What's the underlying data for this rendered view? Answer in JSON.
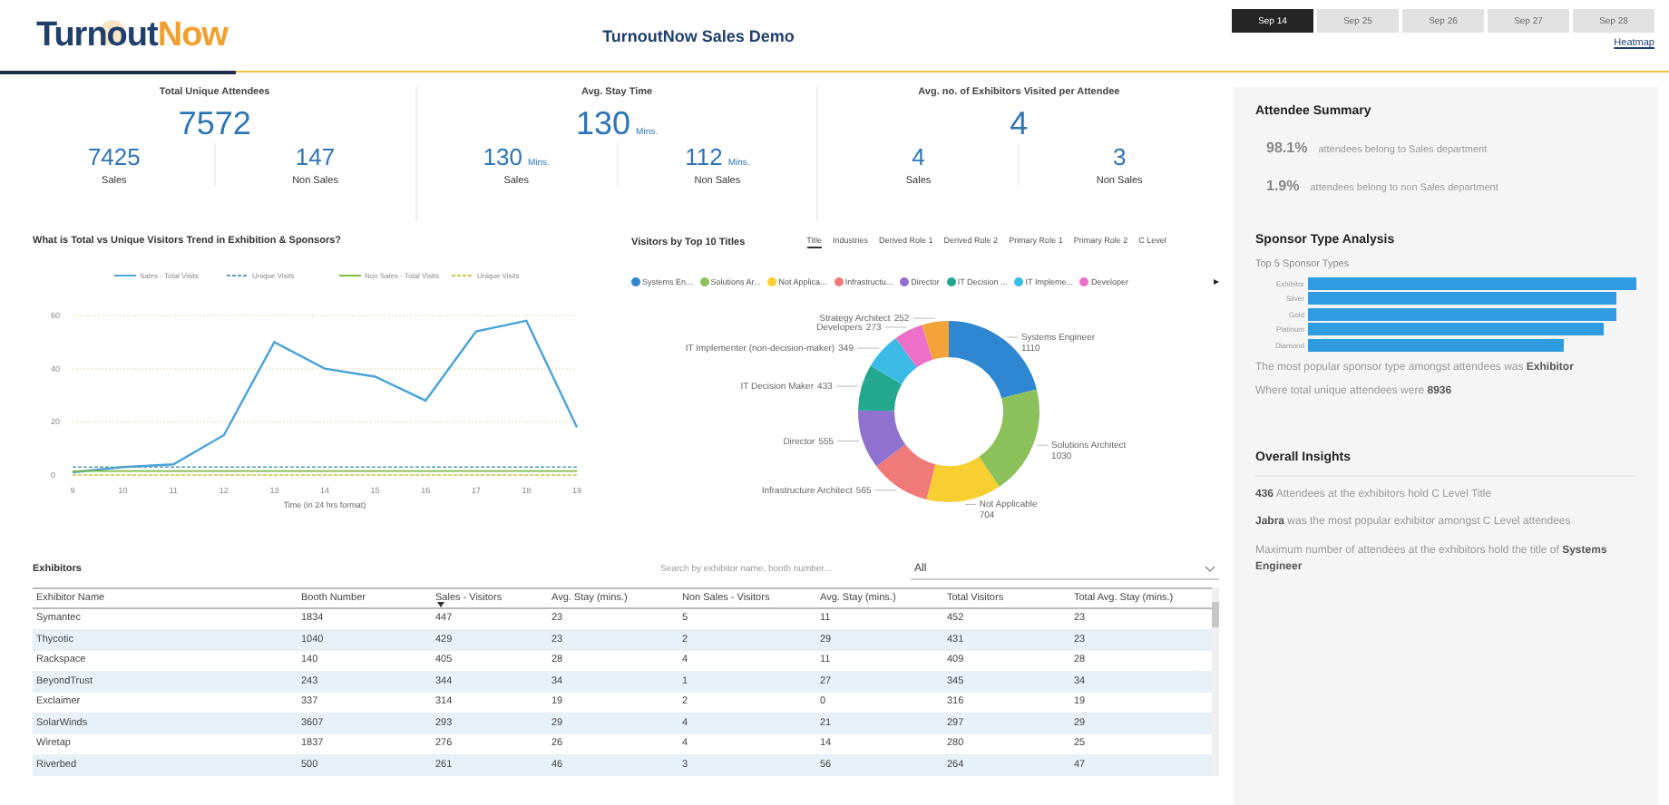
{
  "logo": {
    "text": "Turnout",
    "accent": "Now"
  },
  "title": "TurnoutNow Sales Demo",
  "date_tabs": [
    {
      "label": "Sep 14",
      "selected": true
    },
    {
      "label": "Sep 25",
      "selected": false
    },
    {
      "label": "Sep 26",
      "selected": false
    },
    {
      "label": "Sep 27",
      "selected": false
    },
    {
      "label": "Sep 28",
      "selected": false
    }
  ],
  "heatmap_link": "Heatmap",
  "kpis": [
    {
      "title": "Total Unique Attendees",
      "value": "7572",
      "split": [
        {
          "value": "7425",
          "label": "Sales"
        },
        {
          "value": "147",
          "label": "Non Sales"
        }
      ]
    },
    {
      "title": "Avg. Stay Time",
      "value": "130",
      "unit": "Mins.",
      "split": [
        {
          "value": "130",
          "unit": "Mins.",
          "label": "Sales"
        },
        {
          "value": "112",
          "unit": "Mins.",
          "label": "Non Sales"
        }
      ]
    },
    {
      "title": "Avg. no. of Exhibitors Visited per Attendee",
      "value": "4",
      "split": [
        {
          "value": "4",
          "label": "Sales"
        },
        {
          "value": "3",
          "label": "Non Sales"
        }
      ]
    }
  ],
  "trend": {
    "title": "What is Total vs Unique Visitors Trend in Exhibition & Sponsors?",
    "chart_data": {
      "type": "line",
      "legend": "top",
      "xlabel": "Time (in 24 hrs format)",
      "x": [
        "9",
        "10",
        "11",
        "12",
        "13",
        "14",
        "15",
        "16",
        "17",
        "18",
        "19"
      ],
      "ylim": [
        0,
        60
      ],
      "yticks": [
        0,
        20,
        40,
        60
      ],
      "series": [
        {
          "name": "Sales - Total Visits",
          "color": "#4aa3d9",
          "line_style": "solid",
          "values": [
            1,
            3,
            4,
            15,
            50,
            40,
            37,
            28,
            54,
            58,
            18
          ]
        },
        {
          "name": "Unique Visits",
          "color": "#5a9fb0",
          "line_style": "dashed",
          "values": [
            3,
            3,
            3,
            3,
            3,
            3,
            3,
            3,
            3,
            3,
            3
          ]
        },
        {
          "name": "Non Sales - Total Visits",
          "color": "#7cbd3e",
          "line_style": "solid",
          "values": [
            1.5,
            1.5,
            1.5,
            1.5,
            1.5,
            1.5,
            1.5,
            1.5,
            1.5,
            1.5,
            1.5
          ]
        },
        {
          "name": "Unique Visits",
          "color": "#c8c850",
          "line_style": "dashed",
          "values": [
            0,
            0,
            0,
            0,
            0,
            0,
            0,
            0,
            0,
            0,
            0
          ]
        }
      ]
    }
  },
  "titles": {
    "title": "Visitors by Top 10 Titles",
    "tabs": [
      {
        "label": "Title",
        "selected": true
      },
      {
        "label": "Industries",
        "selected": false
      },
      {
        "label": "Derived Role 1",
        "selected": false
      },
      {
        "label": "Derived Role 2",
        "selected": false
      },
      {
        "label": "Primary Role 1",
        "selected": false
      },
      {
        "label": "Primary Role 2",
        "selected": false
      },
      {
        "label": "C Level",
        "selected": false
      }
    ],
    "legend": [
      {
        "label": "Systems En...",
        "color": "#2f86d1"
      },
      {
        "label": "Solutions Ar...",
        "color": "#8cc05a"
      },
      {
        "label": "Not Applica...",
        "color": "#f7cf30"
      },
      {
        "label": "Infrastructu...",
        "color": "#f0797a"
      },
      {
        "label": "Director",
        "color": "#8f72d0"
      },
      {
        "label": "IT Decision ...",
        "color": "#23a88e"
      },
      {
        "label": "IT Impleme...",
        "color": "#3bbbe6"
      },
      {
        "label": "Developer",
        "color": "#ee6fc8"
      }
    ],
    "legend_more": "▸",
    "chart_data": {
      "type": "donut",
      "data_labels": true,
      "categories": [
        "Systems Engineer",
        "Solutions Architect",
        "Not Applicable",
        "Infrastructure Architect",
        "Director",
        "IT Decision Maker",
        "IT Implementer (non-decision-maker)",
        "Developers",
        "Strategy Architect"
      ],
      "values": [
        1110,
        1030,
        704,
        565,
        555,
        433,
        349,
        273,
        252
      ]
    }
  },
  "exhibitors": {
    "title": "Exhibitors",
    "search": {
      "placeholder": "Search by exhibitor name, booth number..."
    },
    "filter": "All",
    "columns": [
      {
        "label": "Exhibitor Name",
        "sorted": false
      },
      {
        "label": "Booth Number",
        "sorted": false
      },
      {
        "label": "Sales - Visitors",
        "sorted": true
      },
      {
        "label": "Avg. Stay (mins.)",
        "sorted": false
      },
      {
        "label": "Non Sales - Visitors",
        "sorted": false
      },
      {
        "label": "Avg. Stay (mins.)",
        "sorted": false
      },
      {
        "label": "Total Visitors",
        "sorted": false
      },
      {
        "label": "Total Avg. Stay (mins.)",
        "sorted": false
      }
    ],
    "rows": [
      [
        "Symantec",
        "1834",
        "447",
        "23",
        "5",
        "11",
        "452",
        "23"
      ],
      [
        "Thycotic",
        "1040",
        "429",
        "23",
        "2",
        "29",
        "431",
        "23"
      ],
      [
        "Rackspace",
        "140",
        "405",
        "28",
        "4",
        "11",
        "409",
        "28"
      ],
      [
        "BeyondTrust",
        "243",
        "344",
        "34",
        "1",
        "27",
        "345",
        "34"
      ],
      [
        "Exclaimer",
        "337",
        "314",
        "19",
        "2",
        "0",
        "316",
        "19"
      ],
      [
        "SolarWinds",
        "3607",
        "293",
        "29",
        "4",
        "21",
        "297",
        "29"
      ],
      [
        "Wiretap",
        "1837",
        "276",
        "26",
        "4",
        "14",
        "280",
        "25"
      ],
      [
        "Riverbed",
        "500",
        "261",
        "46",
        "3",
        "56",
        "264",
        "47"
      ]
    ]
  },
  "attendee_summary": {
    "title": "Attendee Summary",
    "items": [
      {
        "value": "98.1%",
        "text": "attendees belong to Sales department"
      },
      {
        "value": "1.9%",
        "text": "attendees belong to non Sales department"
      }
    ]
  },
  "sponsor_analysis": {
    "title": "Sponsor Type Analysis",
    "subtitle": "Top 5 Sponsor Types",
    "types": [
      {
        "label": "Exhibitor"
      },
      {
        "label": "Silver"
      },
      {
        "label": "Gold"
      },
      {
        "label": "Platinum"
      },
      {
        "label": "Diamond"
      }
    ],
    "notes": [
      "The most popular sponsor type amongst attendees was **Exhibitor**",
      "Where total unique attendees were **8936**"
    ]
  },
  "insights": {
    "title": "Overall Insights",
    "items": [
      "**436** Attendees at the exhibitors hold C Level Title",
      "**Jabra** was the most popular exhibitor amongst C Level attendees",
      "Maximum number of attendees at the exhibitors hold the title of **Systems Engineer**"
    ]
  }
}
